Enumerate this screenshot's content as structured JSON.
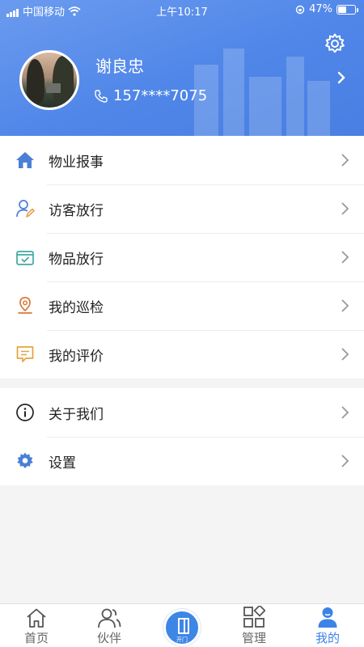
{
  "status_bar": {
    "carrier": "中国移动",
    "time": "上午10:17",
    "battery": "47%"
  },
  "profile": {
    "name": "谢良忠",
    "phone": "157****7075"
  },
  "menu_group_1": [
    {
      "label": "物业报事",
      "icon": "home-icon"
    },
    {
      "label": "访客放行",
      "icon": "visitor-icon"
    },
    {
      "label": "物品放行",
      "icon": "package-check-icon"
    },
    {
      "label": "我的巡检",
      "icon": "location-pin-icon"
    },
    {
      "label": "我的评价",
      "icon": "comment-icon"
    }
  ],
  "menu_group_2": [
    {
      "label": "关于我们",
      "icon": "info-icon"
    },
    {
      "label": "设置",
      "icon": "gear-icon"
    }
  ],
  "tabbar": {
    "tabs": [
      {
        "label": "首页",
        "icon": "home-outline-icon"
      },
      {
        "label": "伙伴",
        "icon": "partners-icon"
      },
      {
        "label": "管理",
        "icon": "grid-manage-icon"
      },
      {
        "label": "我的",
        "icon": "person-icon",
        "active": true
      }
    ],
    "open_door_label": "开门"
  },
  "colors": {
    "header_blue": "#4f86e8",
    "accent": "#3c83e6"
  }
}
